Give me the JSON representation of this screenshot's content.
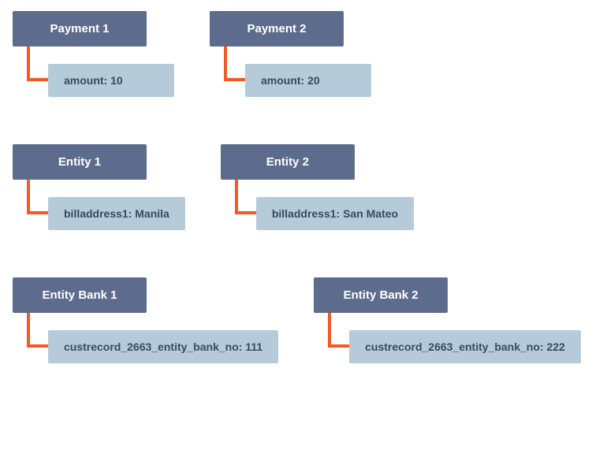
{
  "rows": [
    {
      "items": [
        {
          "parent": "Payment 1",
          "child": "amount: 10"
        },
        {
          "parent": "Payment 2",
          "child": "amount: 20"
        }
      ]
    },
    {
      "items": [
        {
          "parent": "Entity 1",
          "child": "billaddress1: Manila"
        },
        {
          "parent": "Entity 2",
          "child": "billaddress1: San Mateo"
        }
      ]
    },
    {
      "items": [
        {
          "parent": "Entity Bank 1",
          "child": "custrecord_2663_entity_bank_no: 111"
        },
        {
          "parent": "Entity Bank 2",
          "child": "custrecord_2663_entity_bank_no: 222"
        }
      ]
    }
  ]
}
